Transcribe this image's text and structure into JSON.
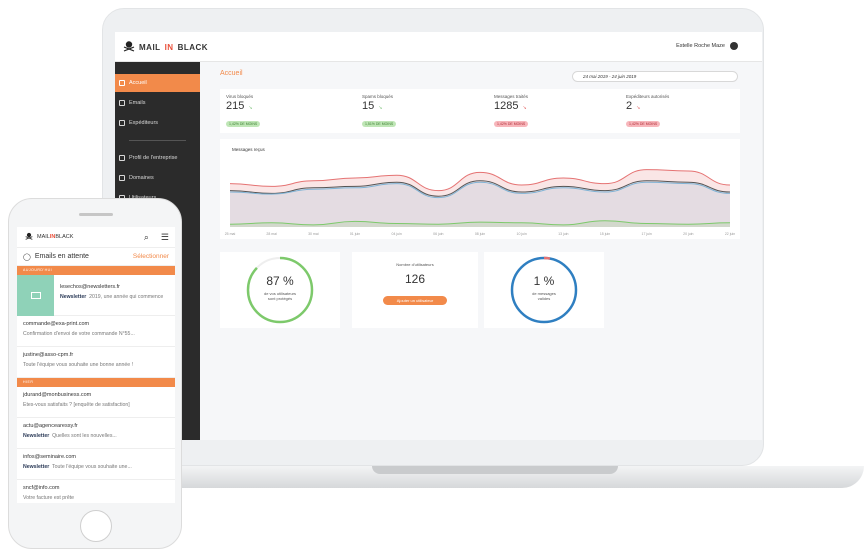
{
  "laptop": {
    "header": {
      "brand_prefix": "MAIL",
      "brand_in": "IN",
      "brand_suffix": "BLACK",
      "user": "Estelle Roche Maze"
    },
    "sidebar": {
      "items": [
        {
          "label": "Accueil",
          "icon": "home-icon",
          "active": true
        },
        {
          "label": "Emails",
          "icon": "mail-icon"
        },
        {
          "label": "Expéditeurs",
          "icon": "senders-icon"
        },
        {
          "label": "Profil de l'entreprise",
          "icon": "company-icon"
        },
        {
          "label": "Domaines",
          "icon": "globe-icon"
        },
        {
          "label": "Utilisateurs",
          "icon": "user-icon"
        }
      ]
    },
    "main": {
      "title": "Accueil",
      "date_range": "24 mai 2019 - 24 juin 2019",
      "stats": [
        {
          "label": "Virus bloqués",
          "value": "215",
          "badge": "1,42% DE MOINS",
          "trend": "down",
          "badge_color": "#bfe6b6"
        },
        {
          "label": "Spams bloqués",
          "value": "15",
          "badge": "1,51% DE MOINS",
          "trend": "down",
          "badge_color": "#bfe6b6"
        },
        {
          "label": "Messages traités",
          "value": "1285",
          "badge": "1,42% DE MOINS",
          "trend": "down",
          "badge_color": "#f7b6bb"
        },
        {
          "label": "Expéditeurs autorisés",
          "value": "2",
          "badge": "1,42% DE MOINS",
          "trend": "down",
          "badge_color": "#f7b6bb"
        }
      ],
      "chart_title": "Messages reçus",
      "chart_x_labels": [
        "25 mai",
        "28 mai",
        "30 mai",
        "01 juin",
        "04 juin",
        "06 juin",
        "08 juin",
        "10 juin",
        "13 juin",
        "15 juin",
        "17 juin",
        "20 juin",
        "22 juin"
      ],
      "kpi": {
        "protected_value": "87 %",
        "protected_label_1": "de vos utilisateurs",
        "protected_label_2": "sont protégés",
        "users_label": "Nombre d'utilisateurs",
        "users_value": "126",
        "add_user": "Ajouter un utilisateur",
        "valid_value": "1 %",
        "valid_label_1": "de messages",
        "valid_label_2": "valides"
      }
    }
  },
  "chart_data": {
    "type": "area",
    "title": "Messages reçus",
    "x": [
      "25 mai",
      "28 mai",
      "30 mai",
      "01 juin",
      "04 juin",
      "06 juin",
      "08 juin",
      "10 juin",
      "13 juin",
      "15 juin",
      "17 juin",
      "20 juin",
      "22 juin"
    ],
    "ylim": [
      0,
      100
    ],
    "series": [
      {
        "values": [
          62,
          58,
          66,
          70,
          74,
          52,
          78,
          60,
          70,
          62,
          82,
          80,
          60
        ],
        "color": "#e57373"
      },
      {
        "values": [
          52,
          48,
          56,
          58,
          64,
          44,
          66,
          50,
          58,
          52,
          66,
          64,
          50
        ],
        "color": "#555555"
      },
      {
        "values": [
          50,
          47,
          54,
          56,
          62,
          42,
          64,
          48,
          56,
          50,
          64,
          62,
          48
        ],
        "color": "#7fb3d5"
      },
      {
        "values": [
          4,
          6,
          3,
          8,
          5,
          4,
          7,
          6,
          3,
          9,
          5,
          4,
          6
        ],
        "color": "#7dc96b"
      }
    ]
  },
  "phone": {
    "brand_prefix": "MAIL",
    "brand_in": "IN",
    "brand_suffix": "BLACK",
    "title": "Emails en attente",
    "select": "Sélectionner",
    "section_today": "AUJOURD'HUI",
    "section_yesterday": "HIER",
    "emails": [
      {
        "from": "lesechos@newsletters.fr",
        "tag": "Newsletter",
        "subject": "2019, une année qui commence",
        "selected": true
      },
      {
        "from": "commande@exa-print.com",
        "subject": "Confirmation d'envoi de votre commande N°55..."
      },
      {
        "from": "justine@asso-cpm.fr",
        "subject": "Toute l'équipe vous souhaite une bonne année !"
      },
      {
        "from": "jdurand@monbusiness.com",
        "subject": "Êtes-vous satisfaits ? [enquête de satisfaction]"
      },
      {
        "from": "actu@agencearessy.fr",
        "tag": "Newsletter",
        "subject": "Quelles sont les nouvelles..."
      },
      {
        "from": "infos@seminaire.com",
        "tag": "Newsletter",
        "subject": "Toute l'équipe vous souhaite une..."
      },
      {
        "from": "sncf@info.com",
        "subject": "Votre facture est prête"
      }
    ]
  }
}
